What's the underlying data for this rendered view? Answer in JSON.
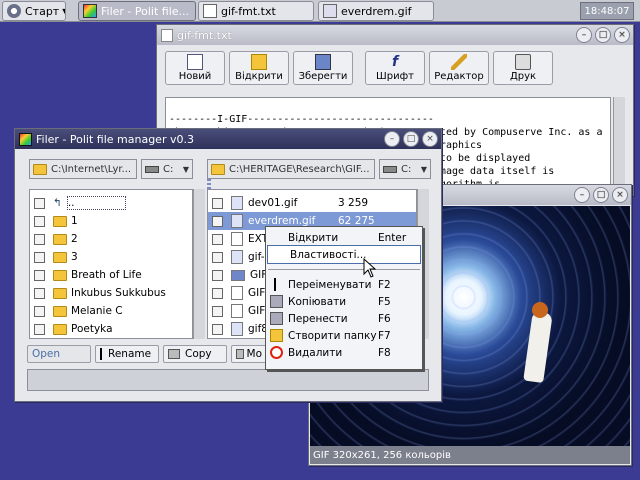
{
  "taskbar": {
    "start_label": "Старт",
    "tasks": [
      {
        "label": "Filer - Polit file..."
      },
      {
        "label": "gif-fmt.txt"
      },
      {
        "label": "everdrem.gif"
      }
    ],
    "clock": "18:48:07"
  },
  "editor": {
    "title": "gif-fmt.txt",
    "toolbar": [
      "Новий",
      "Відкрити",
      "Зберегти",
      "Шрифт",
      "Редактор",
      "Друк"
    ],
    "text_lines": [
      "--------I-GIF-------------------------------",
      "The Graphics Interchange Format (tm) was created by Compuserve Inc. as a",
      "                                   er-based graphics",
      "",
      "                                   which are to be displayed",
      "                                   ges. The image data itself is",
      "                                   the LZW algorithm is"
    ]
  },
  "filer": {
    "title": "Filer - Polit file manager v0.3",
    "left_path": "C:\\Internet\\Lyr...",
    "left_drive": "C:",
    "right_path": "C:\\HERITAGE\\Research\\GIF...",
    "right_drive": "C:",
    "left_items": [
      "..",
      "1",
      "2",
      "3",
      "Breath of Life",
      "Inkubus Sukkubus",
      "Melanie C",
      "Poetyka"
    ],
    "right_items": [
      {
        "name": "dev01.gif",
        "size": "3 259"
      },
      {
        "name": "everdrem.gif",
        "size": "62 275"
      },
      {
        "name": "EXT",
        "size": ""
      },
      {
        "name": "gif-",
        "size": ""
      },
      {
        "name": "GIF",
        "size": ""
      },
      {
        "name": "GIF",
        "size": ""
      },
      {
        "name": "GIF",
        "size": ""
      },
      {
        "name": "gif8",
        "size": ""
      }
    ],
    "buttons": [
      "Open",
      "Rename",
      "Copy",
      "Mo"
    ]
  },
  "context_menu": {
    "items": [
      {
        "label": "Відкрити",
        "key": "Enter"
      },
      {
        "label": "Властивості...",
        "key": ""
      },
      {
        "label": "Переіменувати",
        "key": "F2"
      },
      {
        "label": "Копіювати",
        "key": "F5"
      },
      {
        "label": "Перенести",
        "key": "F6"
      },
      {
        "label": "Створити папку",
        "key": "F7"
      },
      {
        "label": "Видалити",
        "key": "F8"
      }
    ]
  },
  "viewer": {
    "status": "GIF 320x261, 256 кольорів"
  }
}
